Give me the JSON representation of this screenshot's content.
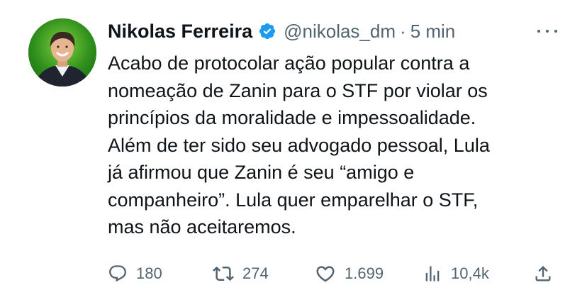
{
  "tweet": {
    "author_name": "Nikolas Ferreira",
    "handle": "@nikolas_dm",
    "separator": "·",
    "time": "5 min",
    "text_lines": [
      "Acabo de protocolar ação popular contra a",
      "nomeação de Zanin para o STF por violar os",
      "princípios da moralidade e impessoalidade.",
      "Além de ter sido seu advogado pessoal, Lula",
      "já afirmou que Zanin é seu “amigo e",
      "companheiro”. Lula quer emparelhar o STF,",
      "mas não aceitaremos."
    ],
    "verified_badge": "verified-badge-icon",
    "more_icon": "more-horizontal-icon"
  },
  "actions": {
    "replies": "180",
    "retweets": "274",
    "likes": "1.699",
    "views": "10,4k",
    "icons": {
      "reply": "reply-icon",
      "retweet": "retweet-icon",
      "like": "heart-icon",
      "views": "views-icon",
      "share": "share-icon"
    }
  },
  "colors": {
    "text": "#0f1419",
    "secondary": "#536471",
    "verified": "#1d9bf0",
    "background": "#ffffff",
    "avatar_bg": "#2f8f1d"
  }
}
